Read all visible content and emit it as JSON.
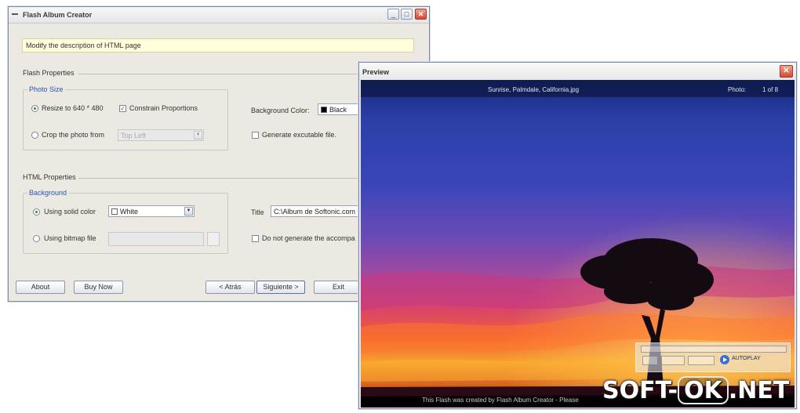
{
  "main_window": {
    "title": "Flash Album Creator",
    "controls": {
      "minimize": "_",
      "maximize": "□",
      "close": "✕"
    },
    "hint": "Modify the description of HTML page",
    "flash_properties": {
      "section_label": "Flash Properties",
      "photo_size_label": "Photo Size",
      "resize_label": "Resize to 640 * 480",
      "constrain_label": "Constrain Proportions",
      "crop_label": "Crop the photo from",
      "crop_value": "Top Left",
      "background_color_label": "Background Color:",
      "background_color_value": "Black",
      "generate_exe_label": "Generate excutable file."
    },
    "html_properties": {
      "section_label": "HTML Properties",
      "background_label": "Background",
      "solid_color_label": "Using solid color",
      "solid_color_value": "White",
      "bitmap_label": "Using bitmap file",
      "title_label": "Title",
      "title_value": "C:\\Album de Softonic.com",
      "no_generate_label": "Do not generate the accompa"
    },
    "buttons": {
      "about": "About",
      "buy_now": "Buy Now",
      "back": "< Atrás",
      "next": "Siguiente >",
      "exit": "Exit"
    }
  },
  "preview_window": {
    "title": "Preview",
    "close": "✕",
    "photo_name": "Sunrise, Palmdale, California.jpg",
    "photo_label": "Photo:",
    "photo_counter": "1 of 8",
    "footer_text": "This Flash was created by Flash Album Creator - Please",
    "autoplay_label": "AUTOPLAY"
  },
  "watermark": {
    "left": "SOFT-",
    "middle": "OK",
    "right": ".NET"
  },
  "colors": {
    "window_bg": "#ece9e3",
    "group_label": "#2a55b3",
    "hint_bg": "#ffffdc",
    "close_red": "#d24a2e"
  }
}
